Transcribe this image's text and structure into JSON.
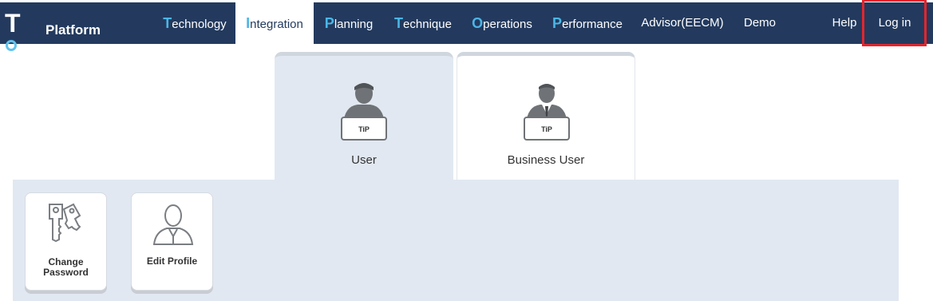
{
  "header": {
    "logo": {
      "mark": "TiP",
      "word": "Platform"
    },
    "nav": [
      {
        "key": "technology",
        "first": "T",
        "rest": "echnology",
        "active": false
      },
      {
        "key": "integration",
        "first": "I",
        "rest": "ntegration",
        "active": true
      },
      {
        "key": "planning",
        "first": "P",
        "rest": "lanning",
        "active": false
      },
      {
        "key": "technique",
        "first": "T",
        "rest": "echnique",
        "active": false
      },
      {
        "key": "operations",
        "first": "O",
        "rest": "perations",
        "active": false
      },
      {
        "key": "performance",
        "first": "P",
        "rest": "erformance",
        "active": false
      }
    ],
    "advisor_label": "Advisor(EECM)",
    "demo_label": "Demo",
    "help_label": "Help",
    "login_label": "Log in"
  },
  "tabs": {
    "user": {
      "label": "User",
      "badge": "TiP",
      "active": true
    },
    "business": {
      "label": "Business User",
      "badge": "TiP",
      "active": false
    }
  },
  "actions": [
    {
      "key": "change-password",
      "line1": "Change",
      "line2": "Password",
      "icon": "keys-icon"
    },
    {
      "key": "edit-profile",
      "line1": "Edit Profile",
      "line2": "",
      "icon": "profile-icon"
    }
  ],
  "colors": {
    "nav_bg": "#233a5e",
    "accent": "#4bb6e6",
    "panel_bg": "#e1e8f1",
    "highlight_border": "#e5242b"
  }
}
